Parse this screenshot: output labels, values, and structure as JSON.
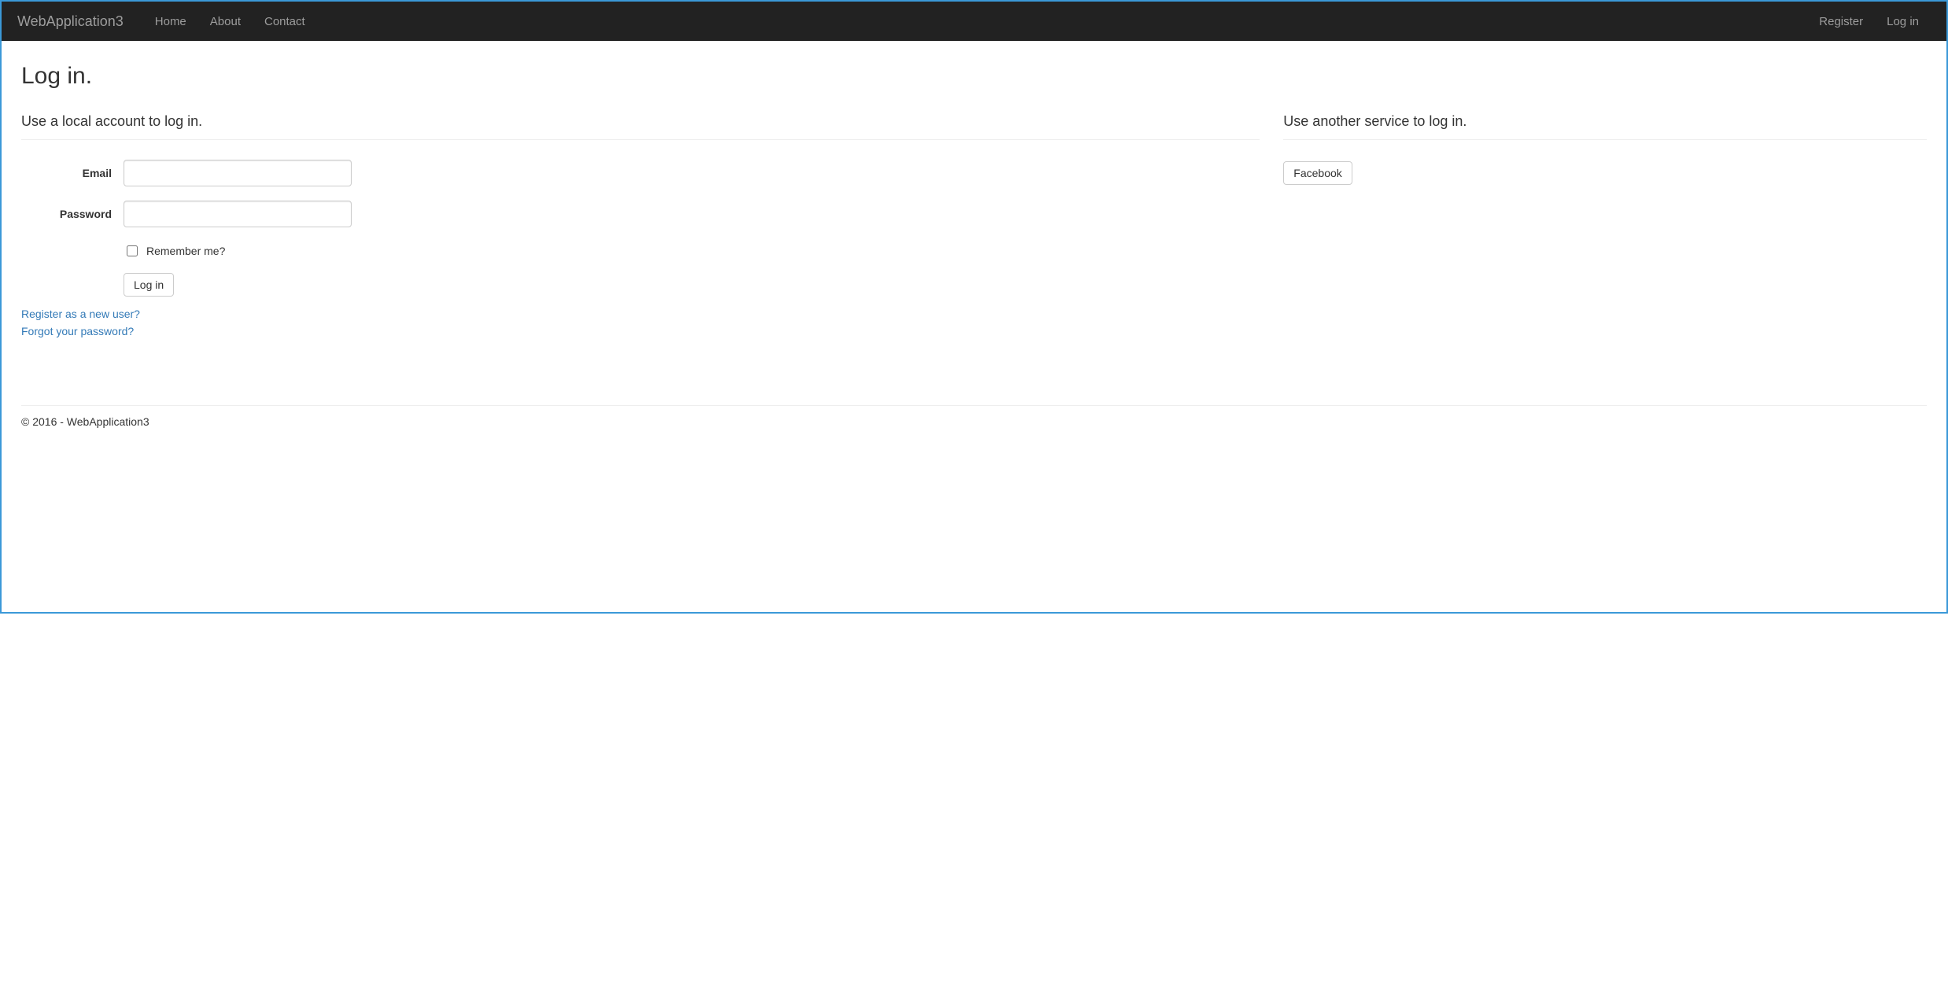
{
  "nav": {
    "brand": "WebApplication3",
    "left": [
      {
        "label": "Home"
      },
      {
        "label": "About"
      },
      {
        "label": "Contact"
      }
    ],
    "right": [
      {
        "label": "Register"
      },
      {
        "label": "Log in"
      }
    ]
  },
  "page": {
    "title": "Log in.",
    "local_section": "Use a local account to log in.",
    "external_section": "Use another service to log in."
  },
  "form": {
    "email_label": "Email",
    "email_value": "",
    "password_label": "Password",
    "password_value": "",
    "remember_label": "Remember me?",
    "remember_checked": false,
    "submit_label": "Log in"
  },
  "links": {
    "register": "Register as a new user?",
    "forgot": "Forgot your password?"
  },
  "external": {
    "facebook_label": "Facebook"
  },
  "footer": {
    "text": "© 2016 - WebApplication3"
  }
}
